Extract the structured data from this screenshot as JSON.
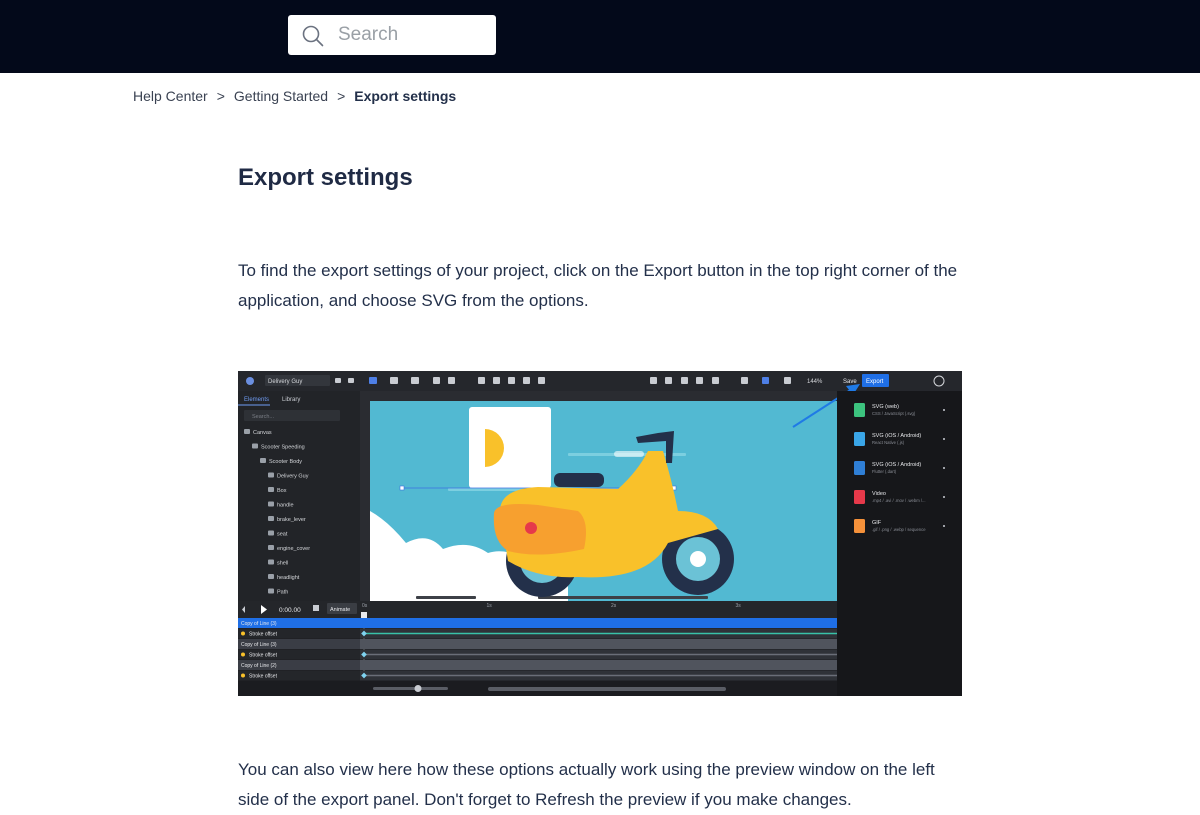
{
  "header": {
    "search_placeholder": "Search"
  },
  "breadcrumb": {
    "items": [
      "Help Center",
      "Getting Started"
    ],
    "separator": ">",
    "current": "Export settings"
  },
  "article": {
    "title": "Export settings",
    "paragraph_1": "To find the export settings of your project, click on the Export button in the top right corner of the application, and choose SVG from the options.",
    "paragraph_2": "You can also view here how these options actually work using the preview window on the left side of the export panel. Don't forget to Refresh the preview if you make changes."
  },
  "screenshot": {
    "toolbar": {
      "file_name": "Delivery Guy",
      "zoom": "144%",
      "save_label": "Save",
      "export_label": "Export"
    },
    "tabs": [
      "Elements",
      "Library"
    ],
    "search_placeholder": "Search...",
    "layers": [
      "Canvas",
      "Scooter Speeding",
      "Scooter Body",
      "Delivery Guy",
      "Box",
      "handle",
      "brake_lever",
      "seat",
      "engine_cover",
      "shell",
      "headlight",
      "Path"
    ],
    "timeline": {
      "time": "0:00.00",
      "animate_label": "Animate",
      "ruler": [
        "0s",
        "1s",
        "2s",
        "3s"
      ],
      "rows": [
        "Copy of Line (3)",
        "Stroke offset",
        "Copy of Line (3)",
        "Stroke offset",
        "Copy of Line (2)",
        "Stroke offset"
      ]
    },
    "export_options": [
      {
        "title": "SVG (web)",
        "sub": "CSS / JavaScript (.svg)",
        "icon": "svg-file-icon",
        "color": "#3cc37e"
      },
      {
        "title": "SVG (iOS / Android)",
        "sub": "React Native (.js)",
        "icon": "react-icon",
        "color": "#3aa6e8"
      },
      {
        "title": "SVG (iOS / Android)",
        "sub": "Flutter (.dart)",
        "icon": "flutter-icon",
        "color": "#2f7fd6"
      },
      {
        "title": "Video",
        "sub": ".mp4 / .avi / .mov / .webm /...",
        "icon": "video-icon",
        "color": "#e6394a"
      },
      {
        "title": "GIF",
        "sub": ".gif / .png / .webp / sequence",
        "icon": "gif-icon",
        "color": "#f5913a"
      }
    ],
    "colors": {
      "editor_bg": "#1e1f23",
      "canvas_bg": "#52b9d2",
      "scooter_yellow": "#f9c12a",
      "export_button": "#1f6fe6",
      "arrow": "#1f7ae6"
    }
  }
}
